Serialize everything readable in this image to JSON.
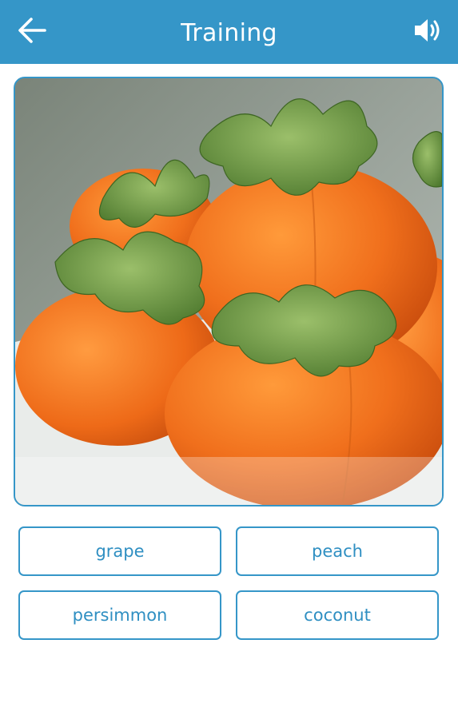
{
  "header": {
    "title": "Training",
    "back_icon": "arrow-left-icon",
    "sound_icon": "speaker-volume-icon",
    "background_color": "#3596c8"
  },
  "question": {
    "image_subject": "persimmons"
  },
  "answers": [
    {
      "label": "grape"
    },
    {
      "label": "peach"
    },
    {
      "label": "persimmon"
    },
    {
      "label": "coconut"
    }
  ],
  "colors": {
    "accent": "#3596c8",
    "answer_text": "#2f8fc2",
    "background": "#ffffff"
  }
}
